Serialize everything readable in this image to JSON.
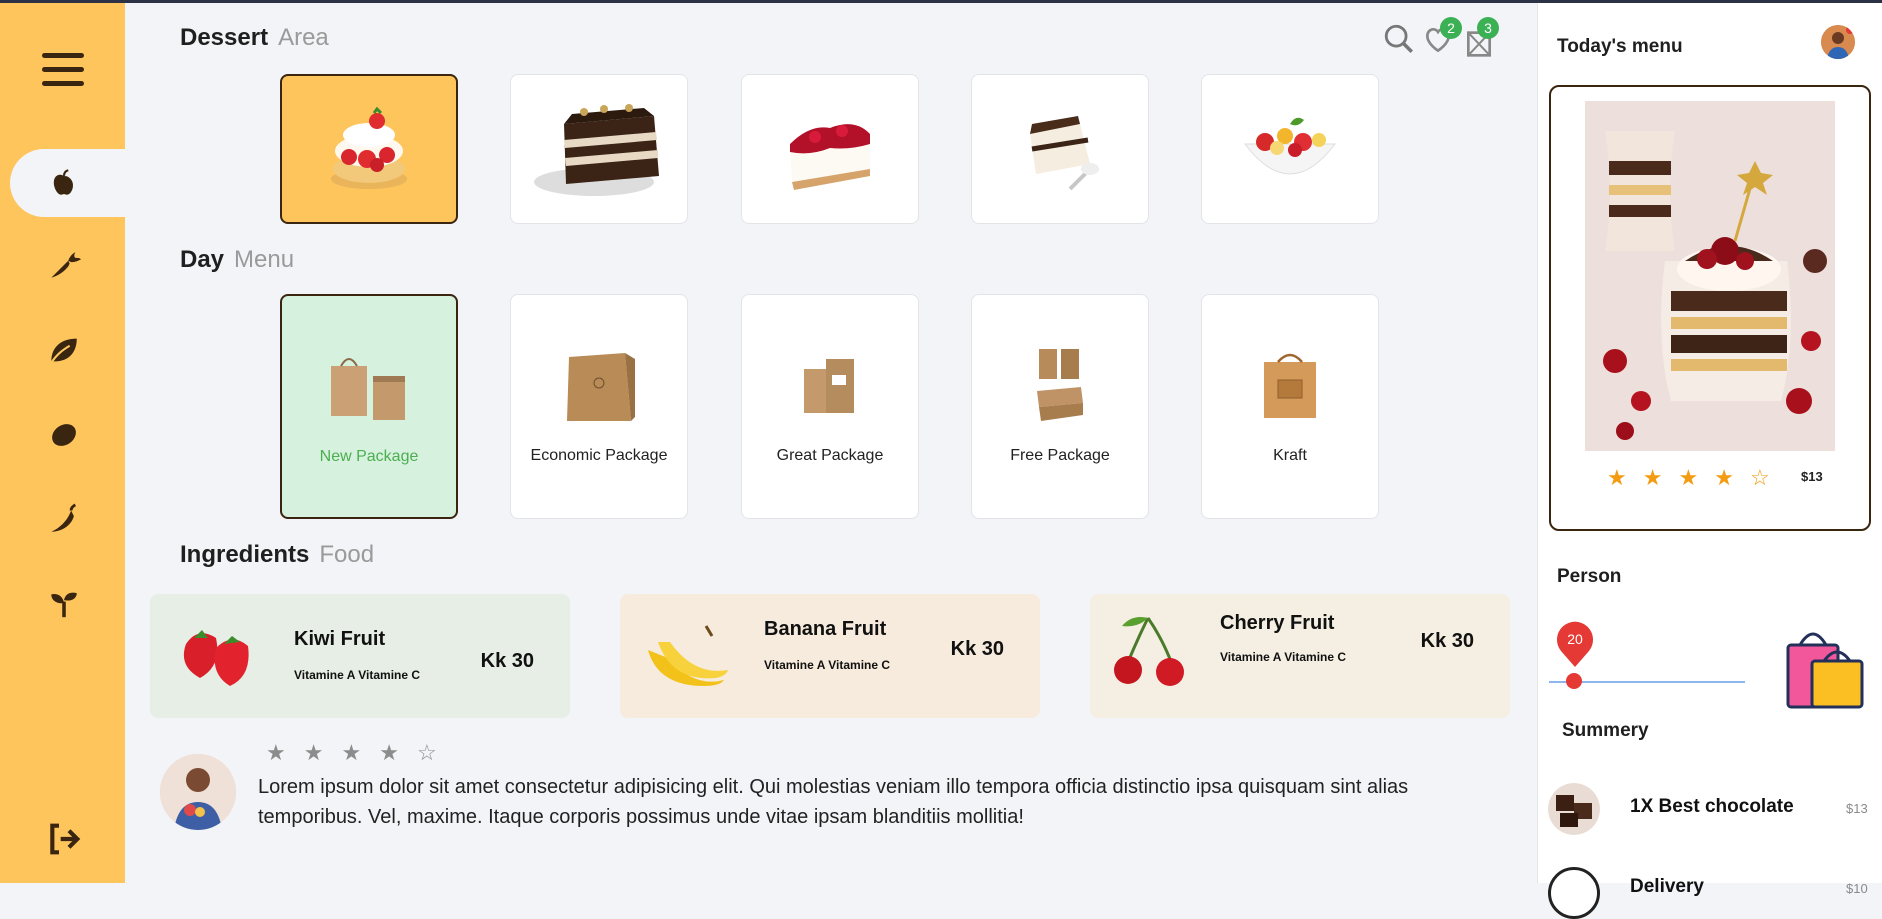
{
  "header": {
    "dessert_title": "Dessert",
    "dessert_sub": "Area",
    "day_title": "Day",
    "day_sub": "Menu",
    "ingredients_title": "Ingredients",
    "ingredients_sub": "Food",
    "wishlist_count": "2",
    "cart_count": "3"
  },
  "sidebar": {
    "items": [
      {
        "icon": "menu-icon"
      },
      {
        "icon": "apple-icon",
        "active": true
      },
      {
        "icon": "carrot-icon"
      },
      {
        "icon": "leaf-icon"
      },
      {
        "icon": "lemon-icon"
      },
      {
        "icon": "chili-icon"
      },
      {
        "icon": "sprout-icon"
      },
      {
        "icon": "logout-icon"
      }
    ]
  },
  "desserts": [
    {
      "name": "strawberry-shortcake",
      "selected": true
    },
    {
      "name": "chocolate-layer-cake"
    },
    {
      "name": "cherry-cheesecake"
    },
    {
      "name": "chocolate-dessert"
    },
    {
      "name": "fruit-salad"
    }
  ],
  "packages": [
    {
      "label": "New Package",
      "selected": true
    },
    {
      "label": "Economic Package"
    },
    {
      "label": "Great Package"
    },
    {
      "label": "Free Package"
    },
    {
      "label": "Kraft"
    }
  ],
  "ingredients": [
    {
      "name": "Kiwi Fruit",
      "vitamins": "Vitamine A Vitamine C",
      "price": "Kk 30",
      "bg": "#e7eee6"
    },
    {
      "name": "Banana Fruit",
      "vitamins": "Vitamine A Vitamine C",
      "price": "Kk 30",
      "bg": "#f6ebdc"
    },
    {
      "name": "Cherry Fruit",
      "vitamins": "Vitamine A Vitamine C",
      "price": "Kk 30",
      "bg": "#f4efe2"
    }
  ],
  "review": {
    "rating": 4,
    "stars": [
      "★",
      "★",
      "★",
      "★",
      "☆"
    ],
    "text": "Lorem ipsum dolor sit amet consectetur adipisicing elit. Qui molestias veniam illo tempora officia distinctio ipsa quisquam sint alias temporibus. Vel, maxime. Itaque corporis possimus unde vitae ipsam blanditiis mollitia!"
  },
  "right_panel": {
    "title": "Today's menu",
    "menu_rating": 4,
    "menu_stars": [
      "★",
      "★",
      "★",
      "★",
      "☆"
    ],
    "menu_price": "$13",
    "person_title": "Person",
    "person_value": "20",
    "summary_title": "Summery",
    "summary_items": [
      {
        "name": "1X Best chocolate",
        "price": "$13"
      },
      {
        "name": "Delivery",
        "price": "$10"
      }
    ]
  },
  "colors": {
    "sidebar": "#fec55c",
    "accent_dark": "#3a2510",
    "selected_package": "#d6f1dd",
    "badge": "#3cb054",
    "star": "#f39c12"
  }
}
